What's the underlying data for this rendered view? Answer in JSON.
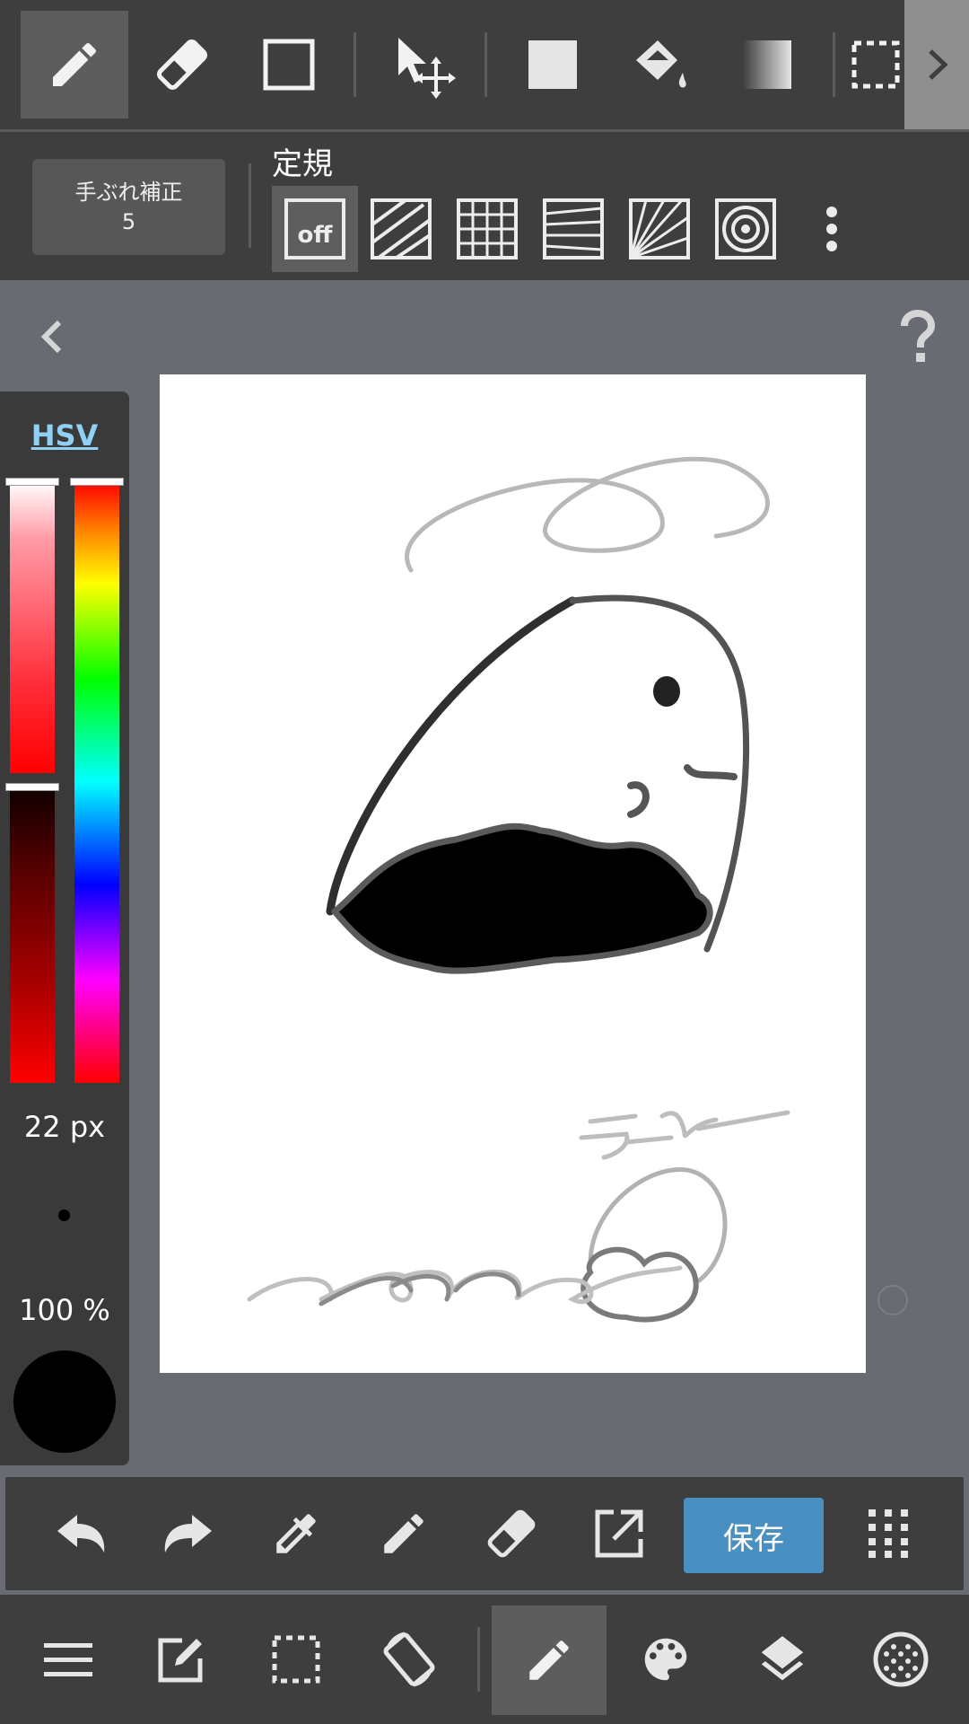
{
  "top_toolbar": {
    "tools": [
      {
        "name": "pen",
        "icon": "pencil-icon",
        "selected": true
      },
      {
        "name": "eraser",
        "icon": "eraser-icon"
      },
      {
        "name": "shape",
        "icon": "square-outline-icon"
      },
      {
        "name": "move",
        "icon": "move-arrow-icon"
      },
      {
        "name": "fill-rect",
        "icon": "filled-square-icon"
      },
      {
        "name": "bucket",
        "icon": "paint-bucket-icon"
      },
      {
        "name": "gradient",
        "icon": "gradient-icon"
      },
      {
        "name": "select",
        "icon": "dashed-selection-icon"
      }
    ],
    "more_icon": "chevron-right-icon"
  },
  "options_bar": {
    "stabilizer_label": "手ぶれ補正",
    "stabilizer_value": "5",
    "ruler_title": "定規",
    "ruler_off_label": "off",
    "rulers": [
      "off",
      "parallel-lines",
      "grid",
      "perspective-lines",
      "radial-lines",
      "concentric-circles"
    ],
    "more_icon": "vertical-dots-icon"
  },
  "color_panel": {
    "mode_tab": "HSV",
    "brush_size": "22 px",
    "opacity": "100 %",
    "current_color": "#000000",
    "hue_marker_fraction": 0.0,
    "saturation_marker_fraction": 1.0,
    "value_marker_fraction": 1.0
  },
  "action_bar": {
    "items": [
      "undo-icon",
      "redo-icon",
      "eyedropper-icon",
      "pencil-icon",
      "eraser-icon",
      "export-icon"
    ],
    "save_label": "保存",
    "grid_icon": "dots-grid-icon"
  },
  "nav_bar": {
    "items": [
      "menu-icon",
      "edit-icon",
      "selection-icon",
      "rotate-screen-icon",
      "brush-icon",
      "palette-icon",
      "layers-icon",
      "material-icon"
    ],
    "selected": "brush-icon"
  },
  "colors": {
    "toolbar_bg": "#3e3e3e",
    "canvas_bg": "#686c72",
    "accent_blue": "#4a8fc2",
    "hsv_link": "#8fd0f4"
  }
}
